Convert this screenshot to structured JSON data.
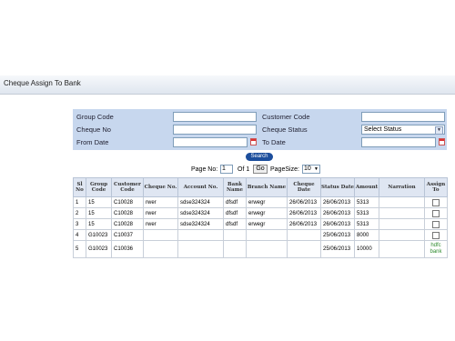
{
  "header": {
    "title": "Cheque Assign To Bank"
  },
  "filters": {
    "group_code_label": "Group Code",
    "customer_code_label": "Customer Code",
    "cheque_no_label": "Cheque No",
    "cheque_status_label": "Cheque Status",
    "cheque_status_value": "Select Status",
    "from_date_label": "From Date",
    "to_date_label": "To Date"
  },
  "search_label": "Search",
  "pager": {
    "page_no_label": "Page No:",
    "page_no_value": "1",
    "of_label": "Of 1",
    "go_label": "Go",
    "page_size_label": "PageSize:",
    "page_size_value": "10"
  },
  "table": {
    "headers": [
      "Sl No",
      "Group Code",
      "Customer Code",
      "Cheque No.",
      "Account No.",
      "Bank Name",
      "Branch Name",
      "Cheque Date",
      "Status Date",
      "Amount",
      "Narration",
      "Assign To"
    ],
    "rows": [
      {
        "sl": "1",
        "group": "15",
        "customer": "C10028",
        "cheque": "rwer",
        "account": "sdse324324",
        "bank": "dfsdf",
        "branch": "erwegr",
        "cheque_date": "26/06/2013",
        "status_date": "26/06/2013",
        "amount": "5313",
        "narration": "",
        "assign": ""
      },
      {
        "sl": "2",
        "group": "15",
        "customer": "C10028",
        "cheque": "rwer",
        "account": "sdse324324",
        "bank": "dfsdf",
        "branch": "erwegr",
        "cheque_date": "26/06/2013",
        "status_date": "26/06/2013",
        "amount": "5313",
        "narration": "",
        "assign": ""
      },
      {
        "sl": "3",
        "group": "15",
        "customer": "C10028",
        "cheque": "rwer",
        "account": "sdse324324",
        "bank": "dfsdf",
        "branch": "erwegr",
        "cheque_date": "26/06/2013",
        "status_date": "26/06/2013",
        "amount": "5313",
        "narration": "",
        "assign": ""
      },
      {
        "sl": "4",
        "group": "G10023",
        "customer": "C10037",
        "cheque": "",
        "account": "",
        "bank": "",
        "branch": "",
        "cheque_date": "",
        "status_date": "25/06/2013",
        "amount": "8000",
        "narration": "",
        "assign": ""
      },
      {
        "sl": "5",
        "group": "G10023",
        "customer": "C10036",
        "cheque": "",
        "account": "",
        "bank": "",
        "branch": "",
        "cheque_date": "",
        "status_date": "25/06/2013",
        "amount": "10000",
        "narration": "",
        "assign": "hdfc bank"
      }
    ]
  }
}
